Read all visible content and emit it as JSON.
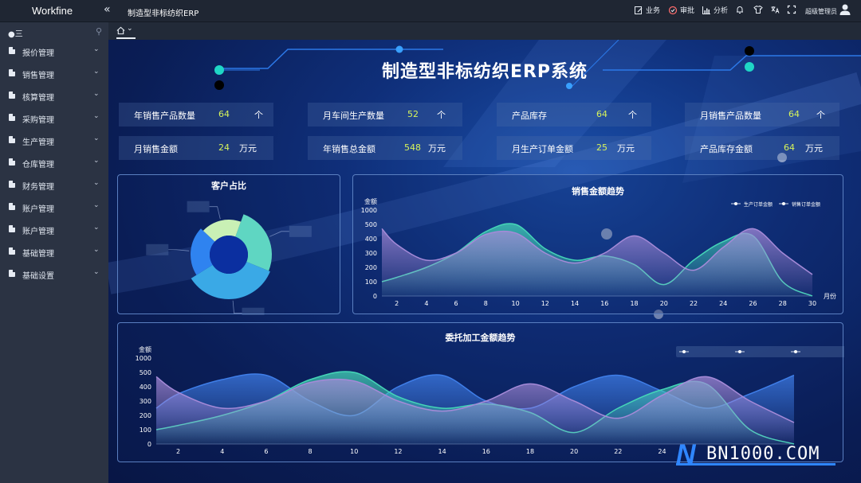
{
  "topbar": {
    "logo": "Workfine",
    "collapse": "«",
    "title": "制造型非标纺织ERP",
    "actions": [
      {
        "icon": "edit-icon",
        "label": "业务"
      },
      {
        "icon": "approve-icon",
        "label": "审批"
      },
      {
        "icon": "bar-chart-icon",
        "label": "分析"
      }
    ],
    "user": "超级管理员"
  },
  "sidebar": {
    "search_label": "三",
    "items": [
      {
        "label": "报价管理"
      },
      {
        "label": "销售管理"
      },
      {
        "label": "核算管理"
      },
      {
        "label": "采购管理"
      },
      {
        "label": "生产管理"
      },
      {
        "label": "仓库管理"
      },
      {
        "label": "财务管理"
      },
      {
        "label": "账户管理"
      },
      {
        "label": "账户管理"
      },
      {
        "label": "基础管理"
      },
      {
        "label": "基础设置"
      }
    ]
  },
  "dashboard": {
    "title": "制造型非标纺织ERP系统",
    "stats": [
      {
        "label": "年销售产品数量",
        "value": "64",
        "unit": "个"
      },
      {
        "label": "月车间生产数量",
        "value": "52",
        "unit": "个"
      },
      {
        "label": "产品库存",
        "value": "64",
        "unit": "个"
      },
      {
        "label": "月销售产品数量",
        "value": "64",
        "unit": "个"
      },
      {
        "label": "月销售金额",
        "value": "24",
        "unit": "万元"
      },
      {
        "label": "年销售总金额",
        "value": "548",
        "unit": "万元"
      },
      {
        "label": "月生产订单金额",
        "value": "25",
        "unit": "万元"
      },
      {
        "label": "产品库存金额",
        "value": "64",
        "unit": "万元"
      }
    ]
  },
  "colors": {
    "accent_green": "#d6f35a",
    "teal": "#45d6b7",
    "purple": "#a58ad8",
    "blue": "#3f7ee8"
  },
  "chart_data": [
    {
      "type": "pie",
      "title": "客户占比",
      "slices": [
        {
          "name": "",
          "value": 22,
          "color": "#5fd6c2"
        },
        {
          "name": "",
          "value": 30,
          "color": "#3aa9e6"
        },
        {
          "name": "",
          "value": 18,
          "color": "#2f83f0"
        },
        {
          "name": "",
          "value": 16,
          "color": "#c9f0b5"
        }
      ]
    },
    {
      "type": "area",
      "title": "销售金额趋势",
      "ylabel": "金额",
      "xlabel": "月份",
      "x": [
        1,
        2,
        4,
        6,
        8,
        10,
        12,
        14,
        16,
        18,
        20,
        22,
        24,
        26,
        28,
        30
      ],
      "xticks": [
        2,
        4,
        6,
        8,
        10,
        12,
        14,
        16,
        18,
        20,
        22,
        24,
        26,
        28,
        30
      ],
      "ylim": [
        0,
        1000
      ],
      "yticks": [
        0,
        100,
        200,
        300,
        400,
        500,
        1000
      ],
      "legend_position": "top-right",
      "series": [
        {
          "name": "生产订单金额",
          "color": "#45d6b7",
          "values": [
            100,
            130,
            200,
            300,
            450,
            500,
            330,
            250,
            280,
            220,
            80,
            250,
            380,
            420,
            100,
            0
          ]
        },
        {
          "name": "销售订单金额",
          "color": "#a58ad8",
          "values": [
            470,
            360,
            250,
            300,
            430,
            440,
            300,
            230,
            300,
            420,
            300,
            180,
            340,
            470,
            300,
            150
          ]
        }
      ]
    },
    {
      "type": "area",
      "title": "委托加工金额趋势",
      "ylabel": "金额",
      "x": [
        1,
        2,
        4,
        6,
        8,
        10,
        12,
        14,
        16,
        18,
        20,
        22,
        24,
        26,
        28,
        30
      ],
      "xticks": [
        2,
        4,
        6,
        8,
        10,
        12,
        14,
        16,
        18,
        20,
        22,
        24
      ],
      "ylim": [
        0,
        1000
      ],
      "yticks": [
        0,
        100,
        200,
        300,
        400,
        500,
        1000
      ],
      "legend_position": "top-right",
      "series": [
        {
          "name": "",
          "color": "#3f7ee8",
          "values": [
            250,
            350,
            450,
            480,
            300,
            200,
            400,
            480,
            300,
            250,
            400,
            480,
            370,
            250,
            350,
            480
          ]
        },
        {
          "name": "",
          "color": "#45d6b7",
          "values": [
            100,
            130,
            200,
            300,
            450,
            500,
            330,
            250,
            280,
            220,
            80,
            250,
            380,
            420,
            100,
            0
          ]
        },
        {
          "name": "",
          "color": "#a58ad8",
          "values": [
            470,
            360,
            250,
            300,
            430,
            440,
            300,
            230,
            300,
            420,
            300,
            180,
            340,
            470,
            300,
            150
          ]
        }
      ]
    }
  ],
  "watermark": {
    "letter": "N",
    "text": "BN1000.COM"
  }
}
